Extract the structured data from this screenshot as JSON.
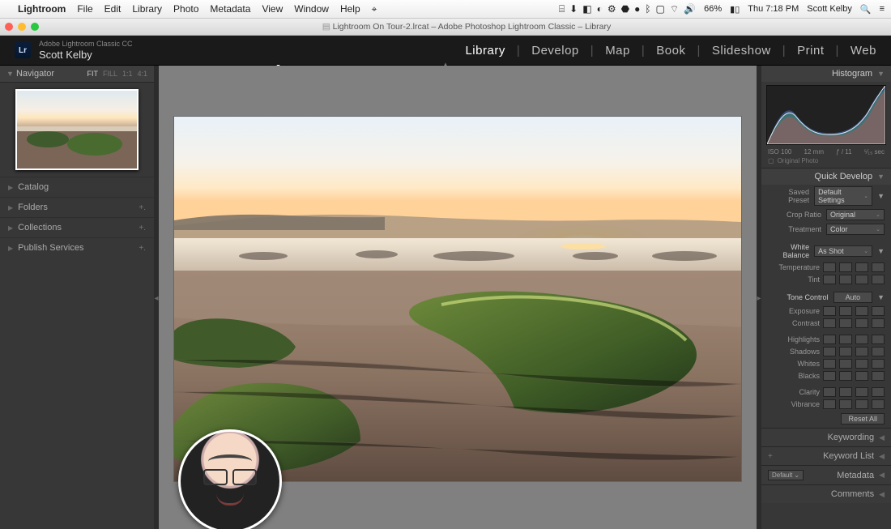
{
  "mac": {
    "app": "Lightroom",
    "menus": [
      "File",
      "Edit",
      "Library",
      "Photo",
      "Metadata",
      "View",
      "Window",
      "Help"
    ],
    "status": {
      "battery": "66%",
      "clock": "Thu 7:18 PM",
      "user": "Scott Kelby",
      "search": "🔍",
      "icons": [
        "⇪",
        "◧",
        "⬇︎",
        "⬛︎",
        "◆",
        "◉",
        "⚙︎",
        "⬣",
        "✱",
        "⏻",
        "✳︎"
      ]
    }
  },
  "window": {
    "title": "Lightroom On Tour-2.lrcat – Adobe Photoshop Lightroom Classic – Library"
  },
  "identity": {
    "brand": "Adobe Lightroom Classic CC",
    "user": "Scott Kelby",
    "logo": "Lr"
  },
  "modules": [
    "Library",
    "Develop",
    "Map",
    "Book",
    "Slideshow",
    "Print",
    "Web"
  ],
  "active_module": "Library",
  "left": {
    "navigator": {
      "label": "Navigator",
      "zoom": [
        "FIT",
        "FILL",
        "1:1",
        "4:1"
      ],
      "zoom_selected": "FIT"
    },
    "sections": [
      {
        "label": "Catalog",
        "plus": ""
      },
      {
        "label": "Folders",
        "plus": "+."
      },
      {
        "label": "Collections",
        "plus": "+."
      },
      {
        "label": "Publish Services",
        "plus": "+."
      }
    ]
  },
  "right": {
    "histogram": {
      "label": "Histogram",
      "iso": "ISO 100",
      "focal": "12 mm",
      "aperture": "ƒ / 11",
      "shutter": "⁵⁄₁₅ sec",
      "original": "Original Photo"
    },
    "quick_develop": {
      "label": "Quick Develop",
      "saved_preset": {
        "lbl": "Saved Preset",
        "val": "Default Settings"
      },
      "crop_ratio": {
        "lbl": "Crop Ratio",
        "val": "Original"
      },
      "treatment": {
        "lbl": "Treatment",
        "val": "Color"
      },
      "white_balance": {
        "lbl": "White Balance",
        "val": "As Shot"
      },
      "temp": "Temperature",
      "tint": "Tint",
      "tone": {
        "lbl": "Tone Control",
        "auto": "Auto"
      },
      "sliders": [
        "Exposure",
        "Contrast",
        "Highlights",
        "Shadows",
        "Whites",
        "Blacks",
        "Clarity",
        "Vibrance"
      ],
      "reset": "Reset All"
    },
    "collapsed": [
      {
        "label": "Keywording"
      },
      {
        "label": "Keyword List",
        "plus": "+"
      },
      {
        "label": "Metadata",
        "preset": "Default"
      },
      {
        "label": "Comments"
      }
    ]
  }
}
